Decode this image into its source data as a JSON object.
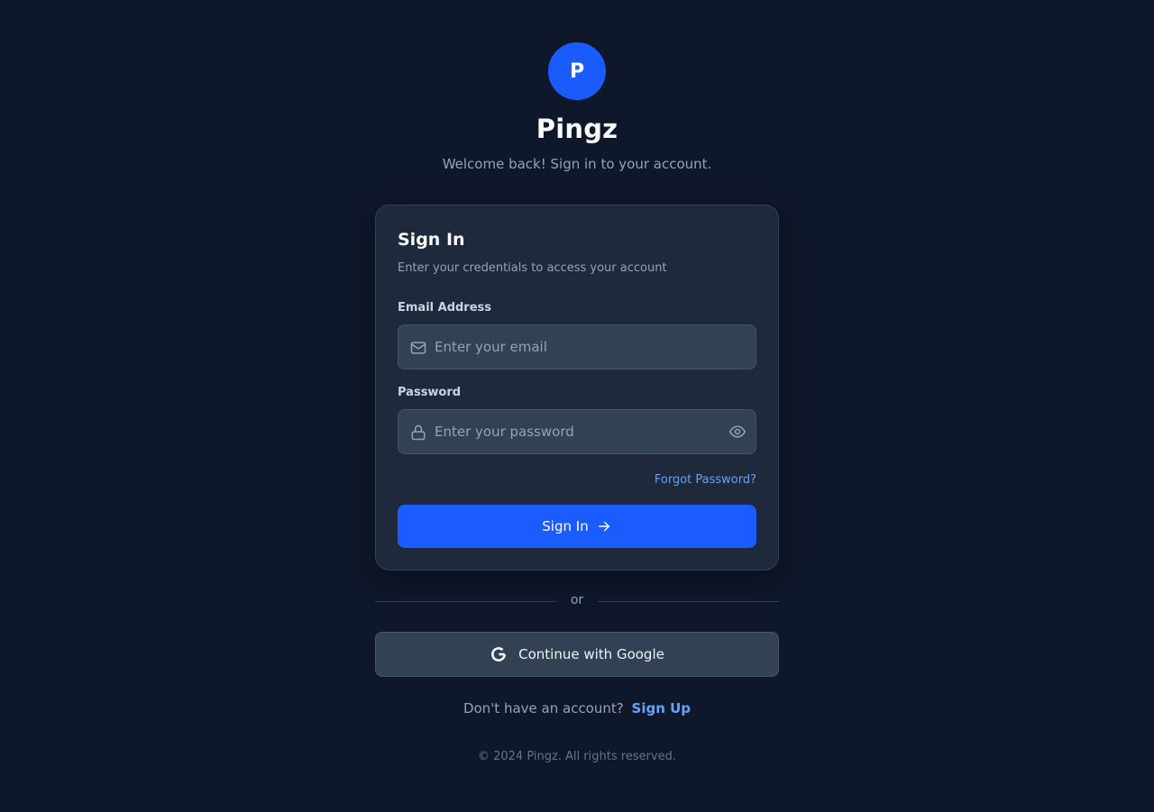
{
  "brand": {
    "logo_letter": "P",
    "name": "Pingz",
    "tagline": "Welcome back! Sign in to your account."
  },
  "card": {
    "title": "Sign In",
    "subtitle": "Enter your credentials to access your account",
    "email": {
      "label": "Email Address",
      "placeholder": "Enter your email",
      "value": "",
      "icon": "mail-icon"
    },
    "password": {
      "label": "Password",
      "placeholder": "Enter your password",
      "value": "",
      "icon": "lock-icon",
      "toggle_icon": "eye-icon"
    },
    "forgot_password": "Forgot Password?",
    "submit_label": "Sign In",
    "submit_icon": "arrow-right-icon"
  },
  "divider_text": "or",
  "google_button": {
    "label": "Continue with Google",
    "icon": "google-icon"
  },
  "signup": {
    "prompt": "Don't have an account?",
    "link": "Sign Up"
  },
  "footer": "© 2024 Pingz. All rights reserved.",
  "colors": {
    "background": "#0f172a",
    "card": "#1e293b",
    "input": "#334155",
    "primary": "#1a5cff",
    "link": "#60a5fa"
  }
}
